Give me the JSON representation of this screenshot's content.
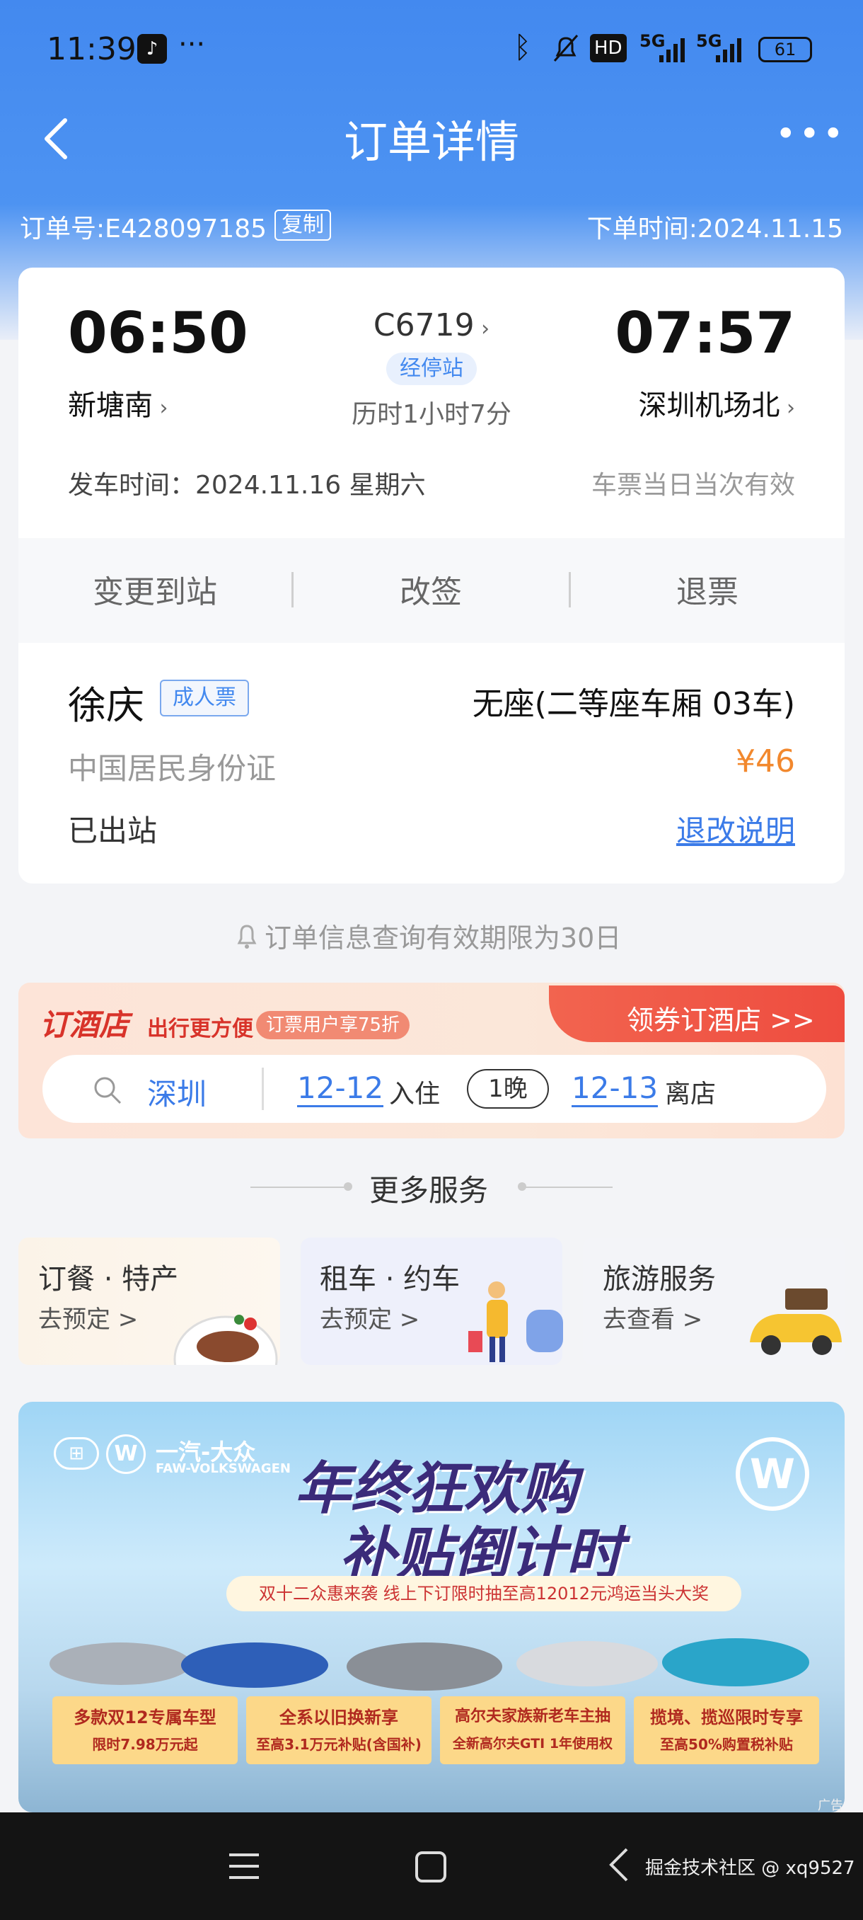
{
  "status_bar": {
    "time": "11:39",
    "dots": "···",
    "hd": "HD",
    "net1": "5G",
    "net2": "5G",
    "battery": "61"
  },
  "header": {
    "title": "订单详情"
  },
  "order": {
    "number": "订单号:E428097185",
    "copy_label": "复制",
    "created": "下单时间:2024.11.15"
  },
  "trip": {
    "depart_time": "06:50",
    "depart_station": "新塘南",
    "train_no": "C6719",
    "stops_label": "经停站",
    "duration": "历时1小时7分",
    "arrive_time": "07:57",
    "arrive_station": "深圳机场北",
    "depart_date": "发车时间：2024.11.16 星期六",
    "validity": "车票当日当次有效"
  },
  "actions": {
    "change_station": "变更到站",
    "reschedule": "改签",
    "refund": "退票"
  },
  "passenger": {
    "name": "徐庆",
    "ticket_type": "成人票",
    "seat": "无座(二等座车厢 03车)",
    "id_type": "中国居民身份证",
    "price": "¥46",
    "status": "已出站",
    "policy_link": "退改说明"
  },
  "notice": "订单信息查询有效期限为30日",
  "hotel": {
    "logo": "订酒店",
    "slogan": "出行更方便",
    "discount": "订票用户享75折",
    "cta": "领券订酒店 >>",
    "city": "深圳",
    "checkin_date": "12-12",
    "checkin_label": "入住",
    "nights": "1晚",
    "checkout_date": "12-13",
    "checkout_label": "离店"
  },
  "more_services": {
    "title": "更多服务",
    "items": [
      {
        "title": "订餐 · 特产",
        "action": "去预定 >"
      },
      {
        "title": "租车 · 约车",
        "action": "去预定 >"
      },
      {
        "title": "旅游服务",
        "action": "去查看 >"
      }
    ]
  },
  "ad": {
    "brand": "一汽-大众",
    "brand_en": "FAW-VOLKSWAGEN",
    "headline1": "年终狂欢购",
    "headline2": "补贴倒计时",
    "strip": "双十二众惠来袭 线上下订限时抽至高12012元鸿运当头大奖",
    "boxes": [
      {
        "title": "多款双12专属车型",
        "sub": "限时7.98万元起"
      },
      {
        "title": "全系以旧换新享",
        "sub": "至高3.1万元补贴(含国补)"
      },
      {
        "title": "高尔夫家族新老车主抽",
        "sub": "全新高尔夫GTI 1年使用权"
      },
      {
        "title": "揽境、揽巡限时专享",
        "sub": "至高50%购置税补贴"
      }
    ],
    "tag": "广告"
  },
  "watermark": "掘金技术社区 @ xq9527",
  "colors": {
    "primary": "#4389ef",
    "price": "#f2882d",
    "link": "#3b7be8",
    "hotel_red": "#e8483c"
  }
}
